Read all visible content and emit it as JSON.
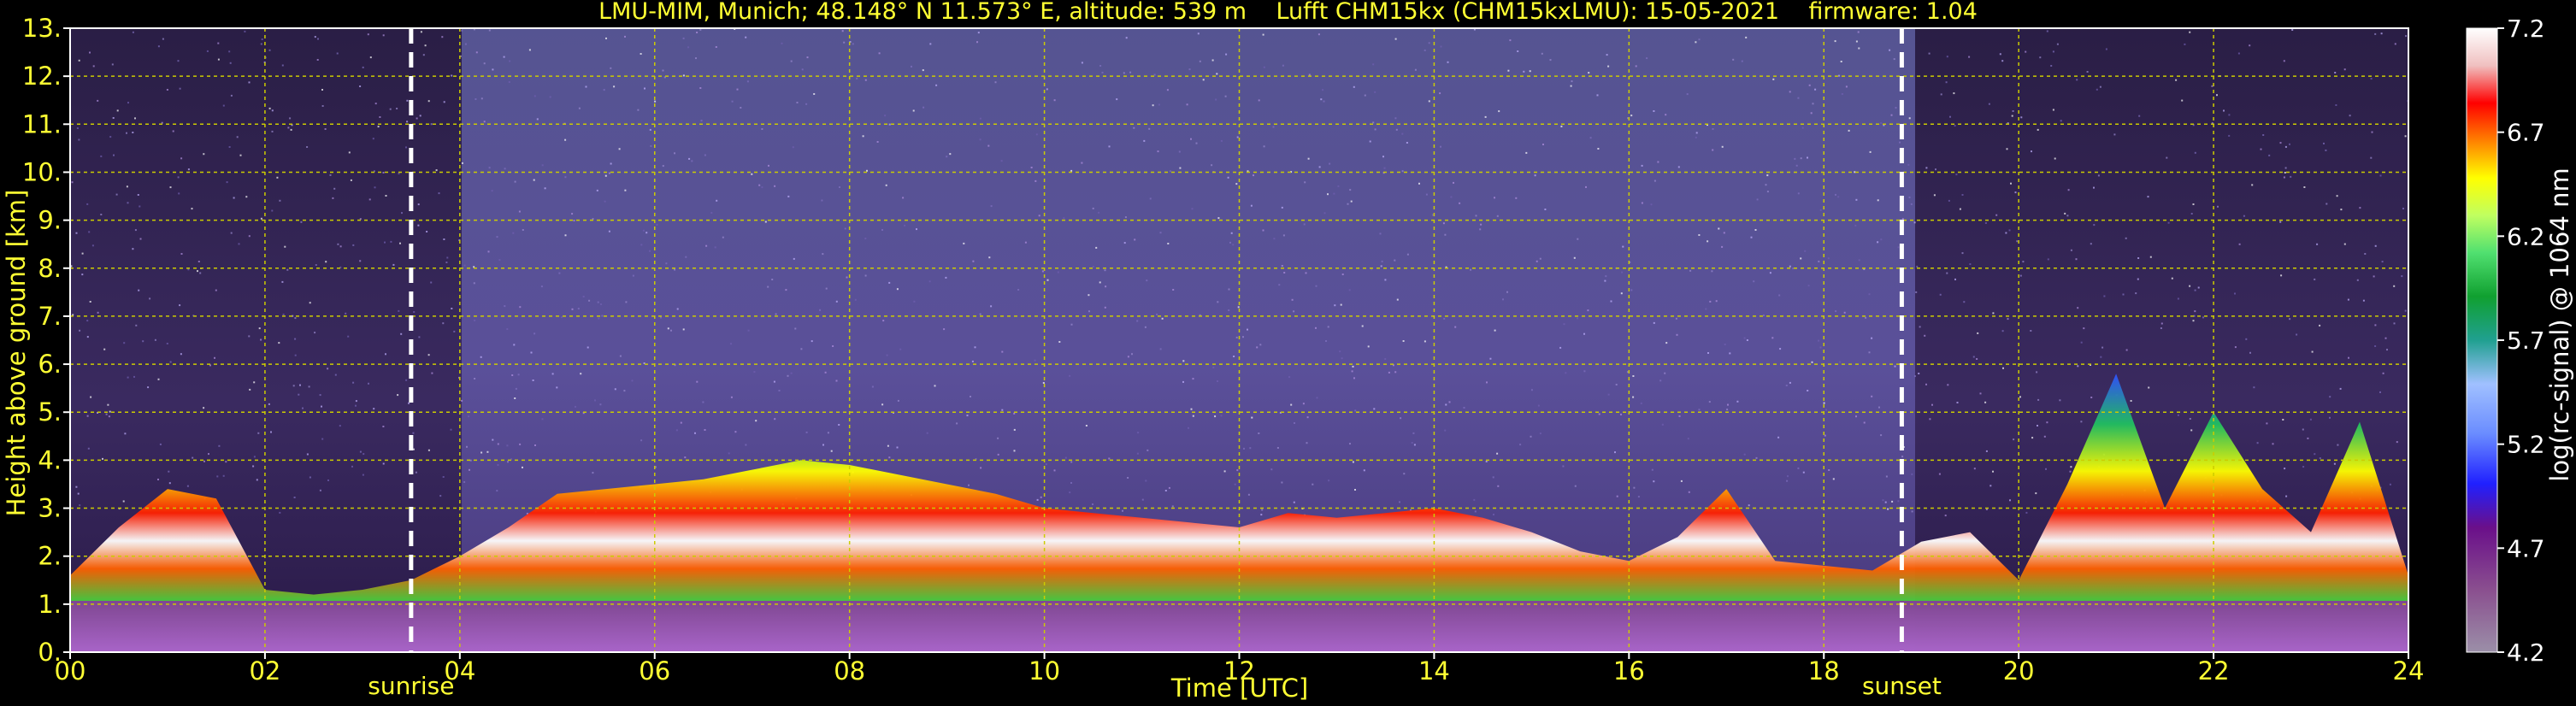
{
  "title": "LMU-MIM, Munich; 48.148° N 11.573° E, altitude: 539 m    Lufft CHM15kx (CHM15kxLMU): 15-05-2021    firmware: 1.04",
  "chart_data": {
    "type": "heatmap",
    "xlabel": "Time [UTC]",
    "ylabel": "Height above ground [km]",
    "xlim": [
      0,
      24
    ],
    "ylim": [
      0,
      13
    ],
    "x_ticks": [
      "00",
      "02",
      "04",
      "06",
      "08",
      "10",
      "12",
      "14",
      "16",
      "18",
      "20",
      "22",
      "24"
    ],
    "y_ticks": [
      "0.",
      "1.",
      "2.",
      "3.",
      "4.",
      "5.",
      "6.",
      "7.",
      "8.",
      "9.",
      "10.",
      "11.",
      "12.",
      "13."
    ],
    "grid": true,
    "colorbar": {
      "label": "log(rc-signal) @ 1064 nm",
      "range": [
        4.2,
        7.2
      ],
      "ticks": [
        "7.2",
        "6.7",
        "6.2",
        "5.7",
        "5.2",
        "4.7",
        "4.2"
      ]
    },
    "events": [
      {
        "label": "sunrise",
        "time": 3.5
      },
      {
        "label": "sunset",
        "time": 18.8
      }
    ],
    "aerosol_layer_top_km": [
      [
        0.0,
        1.6
      ],
      [
        0.5,
        2.6
      ],
      [
        1.0,
        3.4
      ],
      [
        1.5,
        3.2
      ],
      [
        2.0,
        1.3
      ],
      [
        2.5,
        1.2
      ],
      [
        3.0,
        1.3
      ],
      [
        3.5,
        1.5
      ],
      [
        4.0,
        2.0
      ],
      [
        4.5,
        2.6
      ],
      [
        5.0,
        3.3
      ],
      [
        5.5,
        3.4
      ],
      [
        6.0,
        3.5
      ],
      [
        6.5,
        3.6
      ],
      [
        7.0,
        3.8
      ],
      [
        7.5,
        4.0
      ],
      [
        8.0,
        3.9
      ],
      [
        8.5,
        3.7
      ],
      [
        9.0,
        3.5
      ],
      [
        9.5,
        3.3
      ],
      [
        10.0,
        3.0
      ],
      [
        10.5,
        2.9
      ],
      [
        11.0,
        2.8
      ],
      [
        11.5,
        2.7
      ],
      [
        12.0,
        2.6
      ],
      [
        12.5,
        2.9
      ],
      [
        13.0,
        2.8
      ],
      [
        13.5,
        2.9
      ],
      [
        14.0,
        3.0
      ],
      [
        14.5,
        2.8
      ],
      [
        15.0,
        2.5
      ],
      [
        15.5,
        2.1
      ],
      [
        16.0,
        1.9
      ],
      [
        16.5,
        2.4
      ],
      [
        17.0,
        3.4
      ],
      [
        17.5,
        1.9
      ],
      [
        18.0,
        1.8
      ],
      [
        18.5,
        1.7
      ],
      [
        19.0,
        2.3
      ],
      [
        19.5,
        2.5
      ],
      [
        20.0,
        1.5
      ],
      [
        20.5,
        3.5
      ],
      [
        21.0,
        5.8
      ],
      [
        21.5,
        3.0
      ],
      [
        22.0,
        5.0
      ],
      [
        22.5,
        3.4
      ],
      [
        23.0,
        2.5
      ],
      [
        23.5,
        4.8
      ],
      [
        24.0,
        1.6
      ]
    ]
  }
}
